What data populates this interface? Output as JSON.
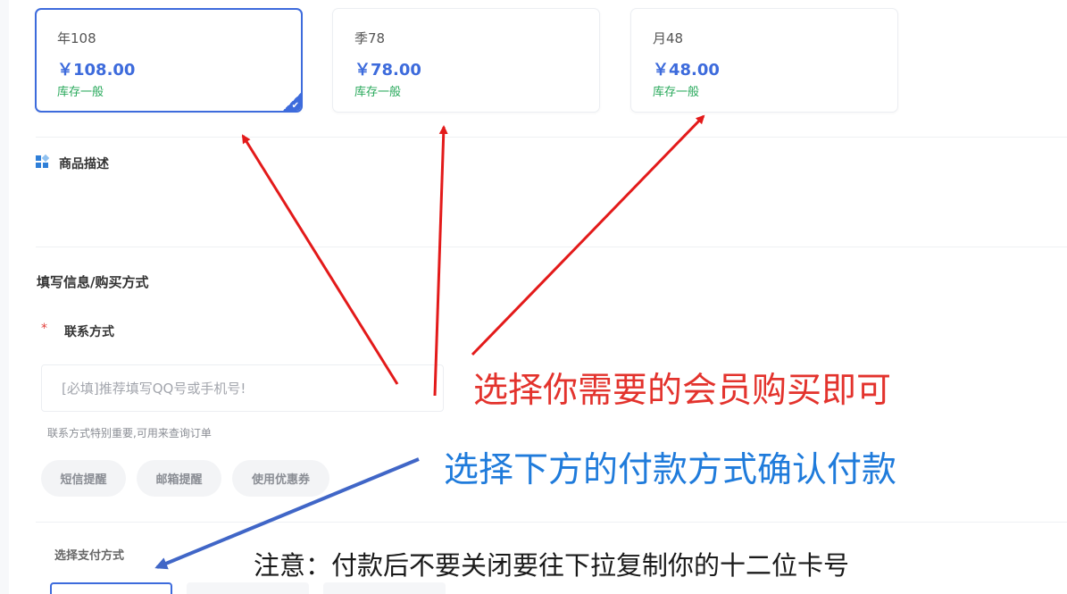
{
  "plans": [
    {
      "name": "年108",
      "price": "￥108.00",
      "stock": "库存一般",
      "selected": true
    },
    {
      "name": "季78",
      "price": "￥78.00",
      "stock": "库存一般",
      "selected": false
    },
    {
      "name": "月48",
      "price": "￥48.00",
      "stock": "库存一般",
      "selected": false
    }
  ],
  "selected_check": "✔",
  "description": {
    "title": "商品描述"
  },
  "form": {
    "title": "填写信息/购买方式",
    "required_mark": "*",
    "contact_label": "联系方式",
    "contact_placeholder": "[必填]推荐填写QQ号或手机号!",
    "contact_value": "",
    "contact_hint": "联系方式特别重要,可用来查询订单",
    "options": [
      "短信提醒",
      "邮箱提醒",
      "使用优惠券"
    ]
  },
  "payment": {
    "title": "选择支付方式"
  },
  "annotations": {
    "red_text": "选择你需要的会员购买即可",
    "blue_text": "选择下方的付款方式确认付款",
    "black_text": "注意：付款后不要关闭要往下拉复制你的十二位卡号"
  },
  "colors": {
    "accent_blue": "#3d6bdc",
    "stock_green": "#27a85a",
    "annotation_red": "#e3332d",
    "annotation_blue": "#1f7bdb",
    "arrow_blue": "#4066c7"
  }
}
